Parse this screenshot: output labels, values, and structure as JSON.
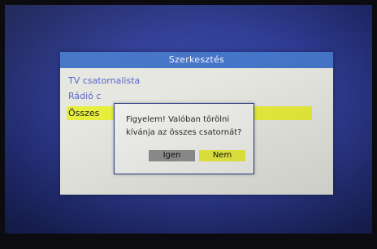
{
  "menu": {
    "title": "Szerkesztés",
    "items": [
      {
        "label": "TV csatornalista"
      },
      {
        "label": "Rádió c"
      },
      {
        "label": "Összes"
      }
    ]
  },
  "dialog": {
    "line1": "Figyelem! Valóban törölni",
    "line2": "kívánja az összes csatornát?",
    "yes_label": "Igen",
    "no_label": "Nem"
  },
  "colors": {
    "header": "#4575c8",
    "highlight": "#e8ee3c",
    "background": "#2f3c93"
  }
}
